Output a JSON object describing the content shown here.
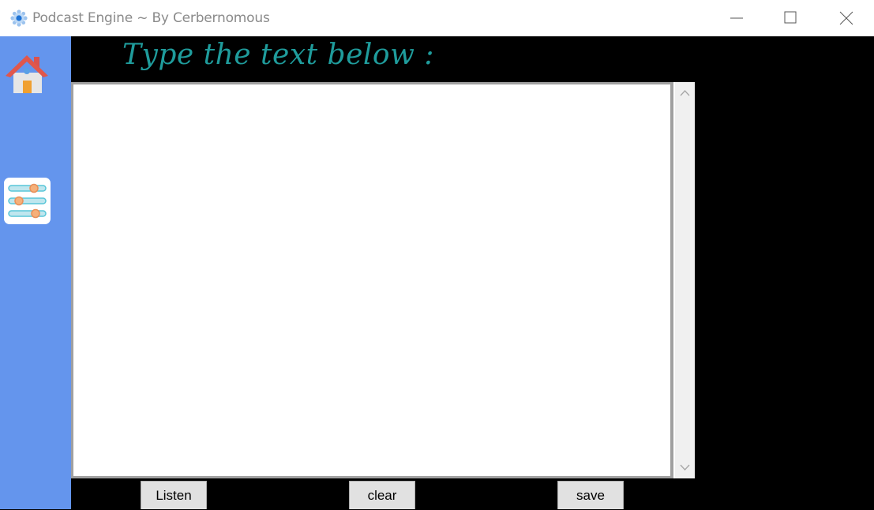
{
  "window": {
    "title": "Podcast Engine ~ By Cerbernomous",
    "app_icon": "gear-icon",
    "controls": [
      "minimize-icon",
      "maximize-icon",
      "close-icon"
    ]
  },
  "sidebar": {
    "background_color": "#6495ed",
    "items": [
      {
        "icon": "home-icon"
      },
      {
        "icon": "settings-sliders-icon"
      }
    ]
  },
  "main": {
    "heading": "Type the text below :",
    "heading_color": "#1f9c9c",
    "text_input": {
      "value": "",
      "placeholder": ""
    },
    "buttons": {
      "listen": "Listen",
      "clear": "clear",
      "save": "save"
    }
  },
  "colors": {
    "content_background": "#000000",
    "button_background": "#e1e1e1"
  }
}
